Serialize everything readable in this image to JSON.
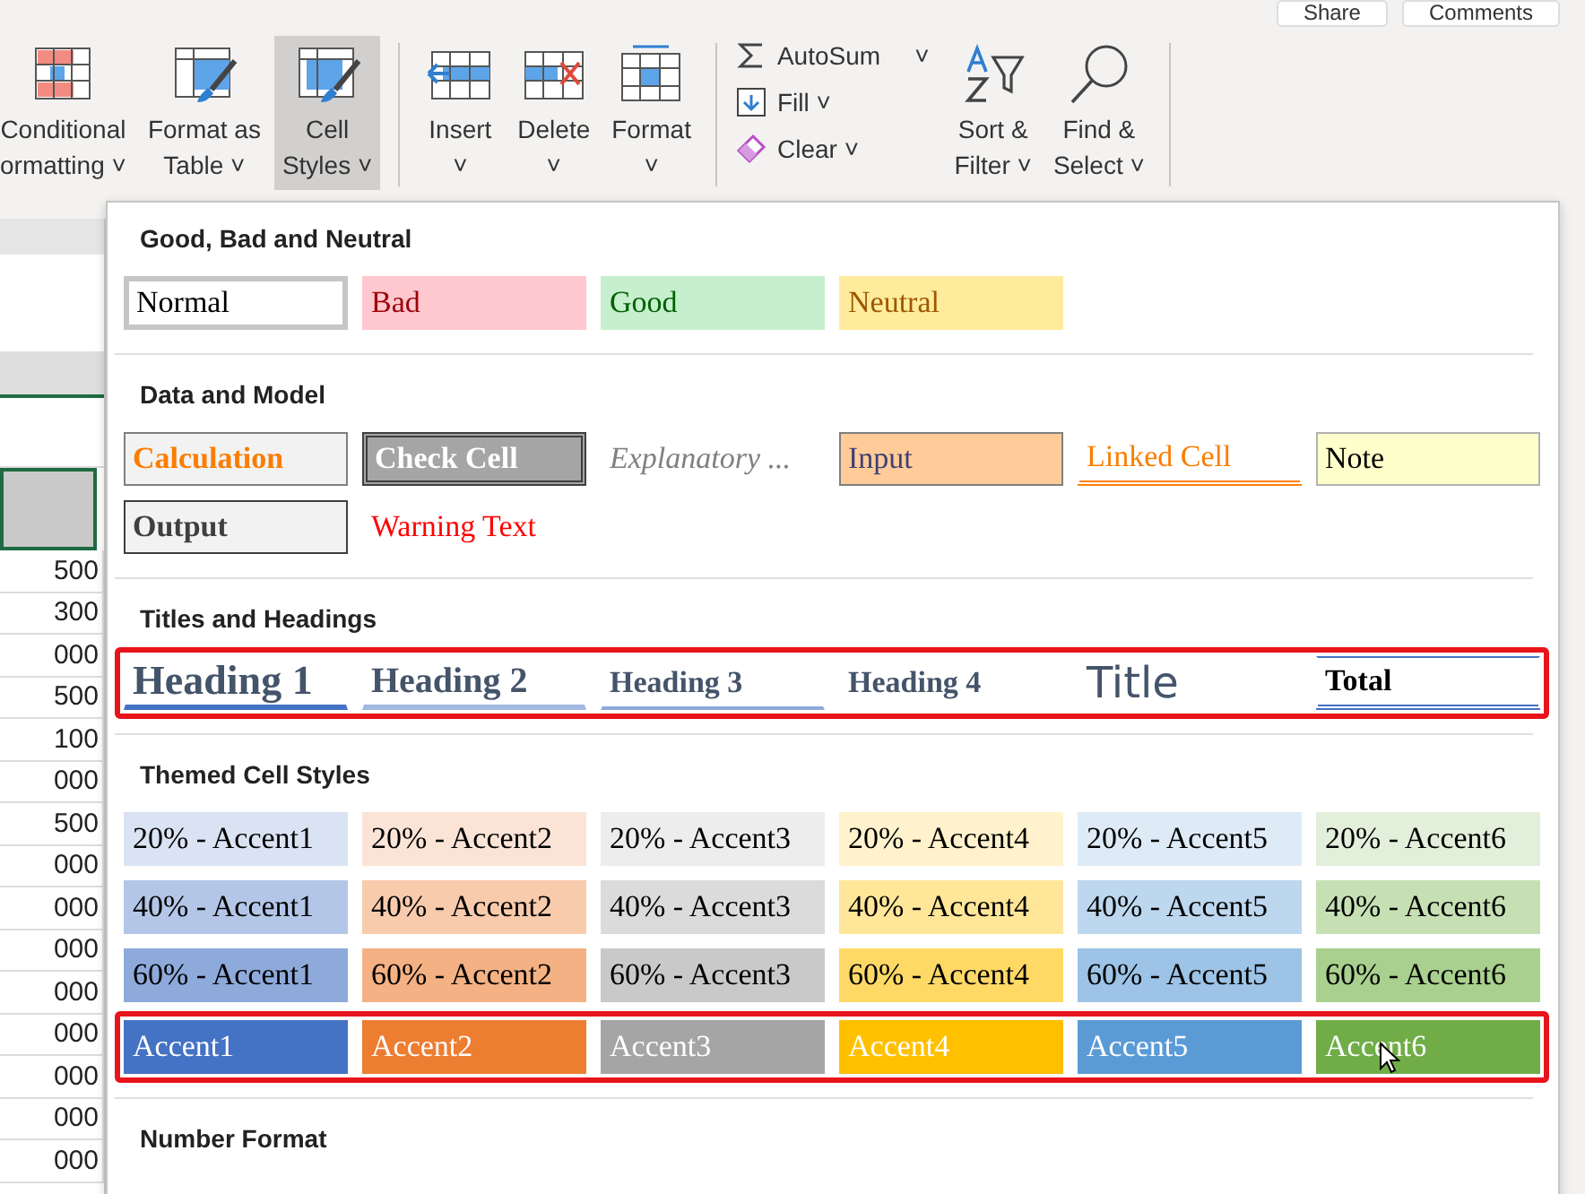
{
  "top_buttons": [
    "Share",
    "Comments"
  ],
  "ribbon": [
    {
      "kind": "conditional",
      "lines": [
        "Conditional",
        "ormatting ˅"
      ],
      "selected": false
    },
    {
      "kind": "table",
      "lines": [
        "Format as",
        "Table ˅"
      ],
      "selected": false
    },
    {
      "kind": "styles",
      "lines": [
        "Cell",
        "Styles ˅"
      ],
      "selected": true
    },
    {
      "kind": "insert",
      "lines": [
        "Insert",
        "˅"
      ],
      "selected": false
    },
    {
      "kind": "delete",
      "lines": [
        "Delete",
        "˅"
      ],
      "selected": false
    },
    {
      "kind": "format",
      "lines": [
        "Format",
        "˅"
      ],
      "selected": false
    }
  ],
  "editing": [
    {
      "kind": "sum",
      "label": "AutoSum",
      "caret": "˅"
    },
    {
      "kind": "fill",
      "label": "Fill ˅"
    },
    {
      "kind": "clear",
      "label": "Clear ˅"
    }
  ],
  "sort": [
    {
      "kind": "sort",
      "lines": [
        "Sort &",
        "Filter ˅"
      ]
    },
    {
      "kind": "find",
      "lines": [
        "Find &",
        "Select ˅"
      ]
    }
  ],
  "sheet_values": [
    "500",
    "300",
    "000",
    "500",
    "100",
    "000",
    "500",
    "000",
    "000",
    "000",
    "000",
    "000",
    "000",
    "000",
    "000"
  ],
  "sections": [
    {
      "title": "Good, Bad and Neutral",
      "highlighted": false,
      "rows": [
        [
          {
            "kind": "normal",
            "text": "Normal"
          },
          {
            "kind": "bad",
            "text": "Bad"
          },
          {
            "kind": "good",
            "text": "Good"
          },
          {
            "kind": "neutral",
            "text": "Neutral"
          }
        ]
      ]
    },
    {
      "title": "Data and Model",
      "highlighted": false,
      "rows": [
        [
          {
            "kind": "calculation",
            "text": "Calculation"
          },
          {
            "kind": "check",
            "text": "Check Cell"
          },
          {
            "kind": "explanatory",
            "text": "Explanatory ..."
          },
          {
            "kind": "input",
            "text": "Input"
          },
          {
            "kind": "linked",
            "text": "Linked Cell"
          },
          {
            "kind": "note",
            "text": "Note"
          }
        ],
        [
          {
            "kind": "output",
            "text": "Output"
          },
          {
            "kind": "warning",
            "text": "Warning Text"
          }
        ]
      ]
    },
    {
      "title": "Titles and Headings",
      "highlighted": true,
      "rows": [
        [
          {
            "kind": "h1",
            "text": "Heading 1"
          },
          {
            "kind": "h2",
            "text": "Heading 2"
          },
          {
            "kind": "h3",
            "text": "Heading 3"
          },
          {
            "kind": "h4",
            "text": "Heading 4"
          },
          {
            "kind": "title",
            "text": "Title"
          },
          {
            "kind": "total",
            "text": "Total"
          }
        ]
      ]
    },
    {
      "title": "Themed Cell Styles",
      "highlighted": false,
      "rows": [
        [
          {
            "kind": "tint",
            "text": "20% - Accent1",
            "color": "#dae3f3"
          },
          {
            "kind": "tint",
            "text": "20% - Accent2",
            "color": "#fbe4d6"
          },
          {
            "kind": "tint",
            "text": "20% - Accent3",
            "color": "#ededed"
          },
          {
            "kind": "tint",
            "text": "20% - Accent4",
            "color": "#fff2cc"
          },
          {
            "kind": "tint",
            "text": "20% - Accent5",
            "color": "#deebf7"
          },
          {
            "kind": "tint",
            "text": "20% - Accent6",
            "color": "#e2efda"
          }
        ],
        [
          {
            "kind": "tint",
            "text": "40% - Accent1",
            "color": "#b4c6e7"
          },
          {
            "kind": "tint",
            "text": "40% - Accent2",
            "color": "#f8cbad"
          },
          {
            "kind": "tint",
            "text": "40% - Accent3",
            "color": "#dbdbdb"
          },
          {
            "kind": "tint",
            "text": "40% - Accent4",
            "color": "#ffe699"
          },
          {
            "kind": "tint",
            "text": "40% - Accent5",
            "color": "#bdd7ee"
          },
          {
            "kind": "tint",
            "text": "40% - Accent6",
            "color": "#c6e0b4"
          }
        ],
        [
          {
            "kind": "tint",
            "text": "60% - Accent1",
            "color": "#8eaadb"
          },
          {
            "kind": "tint",
            "text": "60% - Accent2",
            "color": "#f4b183"
          },
          {
            "kind": "tint",
            "text": "60% - Accent3",
            "color": "#c9c9c9"
          },
          {
            "kind": "tint",
            "text": "60% - Accent4",
            "color": "#ffd966"
          },
          {
            "kind": "tint",
            "text": "60% - Accent5",
            "color": "#9dc3e6"
          },
          {
            "kind": "tint",
            "text": "60% - Accent6",
            "color": "#a9d08e"
          }
        ]
      ]
    },
    {
      "highlighted": true,
      "rows": [
        [
          {
            "kind": "solid",
            "text": "Accent1",
            "color": "#4472c4"
          },
          {
            "kind": "solid",
            "text": "Accent2",
            "color": "#ed7d31"
          },
          {
            "kind": "solid",
            "text": "Accent3",
            "color": "#a5a5a5"
          },
          {
            "kind": "solid",
            "text": "Accent4",
            "color": "#ffc000"
          },
          {
            "kind": "solid",
            "text": "Accent5",
            "color": "#5b9bd5"
          },
          {
            "kind": "solid",
            "text": "Accent6",
            "color": "#70ad47",
            "hovered": true
          }
        ]
      ]
    },
    {
      "title": "Number Format",
      "highlighted": false
    }
  ]
}
